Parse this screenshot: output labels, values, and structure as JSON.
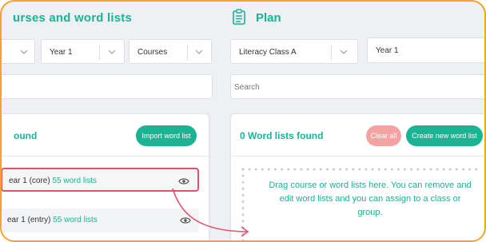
{
  "left": {
    "title": "urses and word lists",
    "filters": [
      {
        "value": ""
      },
      {
        "value": "Year 1"
      },
      {
        "value": "Courses"
      }
    ],
    "search_placeholder": "",
    "panel_title": "ound",
    "import_button": "Import word list",
    "items": [
      {
        "name": "ear 1 (core)",
        "count": "55 word lists",
        "selected": true
      },
      {
        "name": "ear 1 (entry)",
        "count": "55 word lists",
        "selected": false
      }
    ]
  },
  "right": {
    "title": "Plan",
    "filters": [
      {
        "value": "Literacy Class A"
      },
      {
        "value": "Year 1"
      }
    ],
    "search_placeholder": "Search",
    "panel_title": "0 Word lists found",
    "clear_button": "Clear all",
    "create_button": "Create new word list",
    "dropzone_text": "Drag course or word lists here. You can remove and edit word lists and you can assign to a class or group."
  },
  "colors": {
    "accent": "#1ab394",
    "border_highlight": "#f4a623",
    "selected": "#e0536f",
    "danger": "#f4a3a3"
  }
}
